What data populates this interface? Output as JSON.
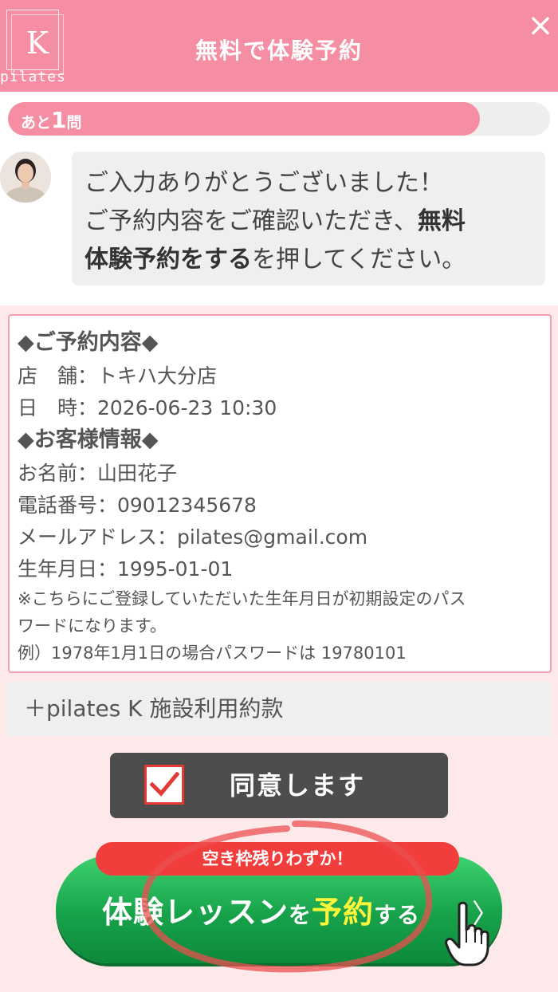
{
  "header": {
    "logo_letter": "K",
    "logo_word": "pilates",
    "title": "無料で体験予約",
    "close_symbol": "×"
  },
  "progress": {
    "prefix": "あと",
    "number": "1",
    "suffix": "問",
    "fill_percent": 87
  },
  "message": {
    "line1": "ご入力ありがとうございました！",
    "line2_normal": "ご予約内容をご確認いただき、",
    "line2_bold": "無料",
    "line3_bold": "体験予約をする",
    "line3_normal": "を押してください。"
  },
  "details": {
    "reservation_heading": "◆ご予約内容◆",
    "store": "店　舗：トキハ大分店",
    "datetime": "日　時：2026-06-23 10:30",
    "customer_heading": "◆お客様情報◆",
    "name": "お名前：山田花子",
    "phone": "電話番号：09012345678",
    "email": "メールアドレス：pilates@gmail.com",
    "birthday": "生年月日：1995-01-01",
    "note1": "※こちらにご登録していただいた生年月日が初期設定のパス",
    "note2": "ワードになります。",
    "note3": "例）1978年1月1日の場合パスワードは 19780101"
  },
  "terms": {
    "label": "＋pilates K 施設利用約款"
  },
  "agree": {
    "label": "同意します",
    "checked": true
  },
  "cta": {
    "badge": "空き枠残りわずか！",
    "part1": "体験レッスン",
    "part2": "を",
    "part3": "予約",
    "part4": "する",
    "chevron": "〉"
  },
  "colors": {
    "header_pink": "#f58ea3",
    "background_pink": "#fde8ea",
    "cta_green": "#17a24a",
    "badge_red": "#f23d3d",
    "highlight_yellow": "#fff53a"
  }
}
